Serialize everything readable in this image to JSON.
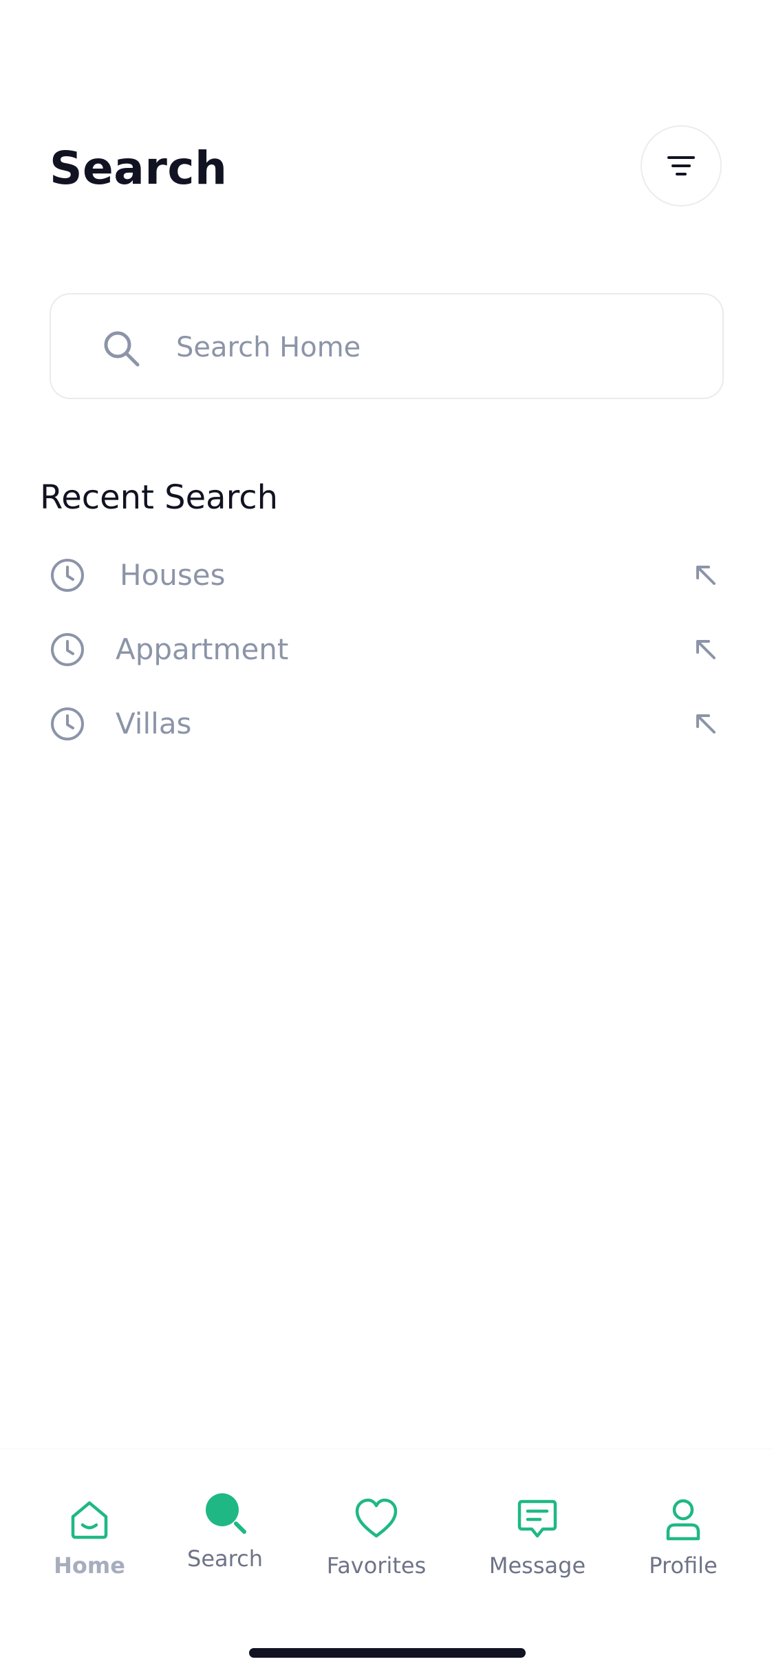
{
  "header": {
    "title": "Search",
    "filter_icon": "filter-lines-icon"
  },
  "search": {
    "placeholder": "Search Home",
    "value": "",
    "icon": "search-icon"
  },
  "recent": {
    "title": "Recent Search",
    "items": [
      {
        "label": "Houses",
        "icon": "clock-icon",
        "action_icon": "arrow-up-left-icon"
      },
      {
        "label": "Appartment",
        "icon": "clock-icon",
        "action_icon": "arrow-up-left-icon"
      },
      {
        "label": "Villas",
        "icon": "clock-icon",
        "action_icon": "arrow-up-left-icon"
      }
    ]
  },
  "tabbar": {
    "items": [
      {
        "label": "Home",
        "icon": "home-icon"
      },
      {
        "label": "Search",
        "icon": "search-icon",
        "active": true
      },
      {
        "label": "Favorites",
        "icon": "heart-icon"
      },
      {
        "label": "Message",
        "icon": "message-icon"
      },
      {
        "label": "Profile",
        "icon": "user-icon"
      }
    ]
  },
  "colors": {
    "accent": "#1fb885",
    "text_primary": "#111322",
    "text_muted": "#8c94a8",
    "border": "#ebebee"
  }
}
